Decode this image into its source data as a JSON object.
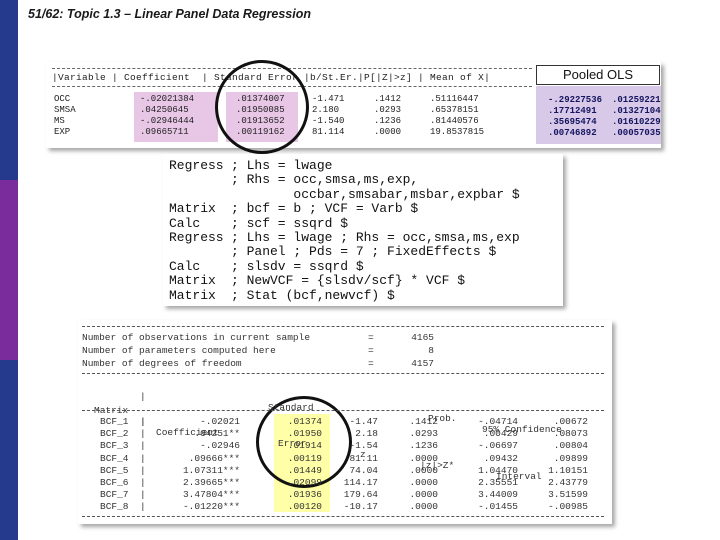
{
  "slide": {
    "title": "51/62: Topic 1.3 – Linear Panel Data Regression"
  },
  "colors": {
    "sidebar": [
      "#253a8c",
      "#7a2c9c",
      "#253a8c"
    ],
    "pink_highlight": "#e7c6e6",
    "yellow_highlight": "#ffffa8",
    "pooled_bg": "#d8c9e8"
  },
  "top_table": {
    "header": "|Variable | Coefficient  | Standard Error |b/St.Er.|P[|Z|>z] | Mean of X|",
    "rows": [
      {
        "var": "OCC",
        "coef": "-.02021384",
        "se": ".01374007",
        "z": "-1.471",
        "p": ".1412",
        "mean": ".51116447"
      },
      {
        "var": "SMSA",
        "coef": ".04250645",
        "se": ".01950085",
        "z": "2.180",
        "p": ".0293",
        "mean": ".65378151"
      },
      {
        "var": "MS",
        "coef": "-.02946444",
        "se": ".01913652",
        "z": "-1.540",
        "p": ".1236",
        "mean": ".81440576"
      },
      {
        "var": "EXP",
        "coef": ".09665711",
        "se": ".00119162",
        "z": "81.114",
        "p": ".0000",
        "mean": "19.8537815"
      }
    ],
    "pooled_label": "Pooled OLS",
    "pooled_rows": [
      {
        "coef": "-.29227536",
        "se": ".01259221"
      },
      {
        "coef": ".17712491",
        "se": ".01327104"
      },
      {
        "coef": ".35695474",
        "se": ".01610229"
      },
      {
        "coef": ".00746892",
        "se": ".00057035"
      }
    ]
  },
  "code_lines": [
    {
      "kw": "Regress",
      "rest": "; Lhs = lwage"
    },
    {
      "kw": "",
      "rest": "; Rhs = occ,smsa,ms,exp,"
    },
    {
      "kw": "",
      "rest": "        occbar,smsabar,msbar,expbar $"
    },
    {
      "kw": "Matrix",
      "rest": "; bcf = b ; VCF = Varb $"
    },
    {
      "kw": "Calc",
      "rest": "; scf = ssqrd $"
    },
    {
      "kw": "Regress",
      "rest": "; Lhs = lwage ; Rhs = occ,smsa,ms,exp"
    },
    {
      "kw": "",
      "rest": "; Panel ; Pds = 7 ; FixedEffects $"
    },
    {
      "kw": "Calc",
      "rest": "; slsdv = ssqrd $"
    },
    {
      "kw": "Matrix",
      "rest": "; NewVCF = {slsdv/scf} * VCF $"
    },
    {
      "kw": "Matrix",
      "rest": "; Stat (bcf,newvcf) $"
    }
  ],
  "bottom": {
    "summary": [
      {
        "label": "Number of observations in current sample",
        "eq": "=",
        "value": "4165"
      },
      {
        "label": "Number of parameters computed here",
        "eq": "=",
        "value": "8"
      },
      {
        "label": "Number of degrees of freedom",
        "eq": "=",
        "value": "4157"
      }
    ],
    "header1": {
      "col_se": "Standard",
      "col_p": "Prob.",
      "col_ci": "95% Confidence"
    },
    "header2": {
      "col_matrix": "Matrix",
      "col_coef": "Coefficient",
      "col_se": "Error",
      "col_z": "z",
      "col_p": "|z|>Z*",
      "col_ci": "Interval"
    },
    "rows": [
      {
        "name": "BCF_1",
        "coef": "-.02021",
        "se": ".01374",
        "z": "-1.47",
        "p": ".1412",
        "lo": "-.04714",
        "hi": ".00672"
      },
      {
        "name": "BCF_2",
        "coef": ".04251**",
        "se": ".01950",
        "z": "2.18",
        "p": ".0293",
        "lo": ".00429",
        "hi": ".08073"
      },
      {
        "name": "BCF_3",
        "coef": "-.02946",
        "se": ".01914",
        "z": "-1.54",
        "p": ".1236",
        "lo": "-.06697",
        "hi": ".00804"
      },
      {
        "name": "BCF_4",
        "coef": ".09666***",
        "se": ".00119",
        "z": "81.11",
        "p": ".0000",
        "lo": ".09432",
        "hi": ".09899"
      },
      {
        "name": "BCF_5",
        "coef": "1.07311***",
        "se": ".01449",
        "z": "74.04",
        "p": ".0000",
        "lo": "1.04470",
        "hi": "1.10151"
      },
      {
        "name": "BCF_6",
        "coef": "2.39665***",
        "se": ".02099",
        "z": "114.17",
        "p": ".0000",
        "lo": "2.35551",
        "hi": "2.43779"
      },
      {
        "name": "BCF_7",
        "coef": "3.47804***",
        "se": ".01936",
        "z": "179.64",
        "p": ".0000",
        "lo": "3.44009",
        "hi": "3.51599"
      },
      {
        "name": "BCF_8",
        "coef": "-.01220***",
        "se": ".00120",
        "z": "-10.17",
        "p": ".0000",
        "lo": "-.01455",
        "hi": "-.00985"
      }
    ]
  }
}
